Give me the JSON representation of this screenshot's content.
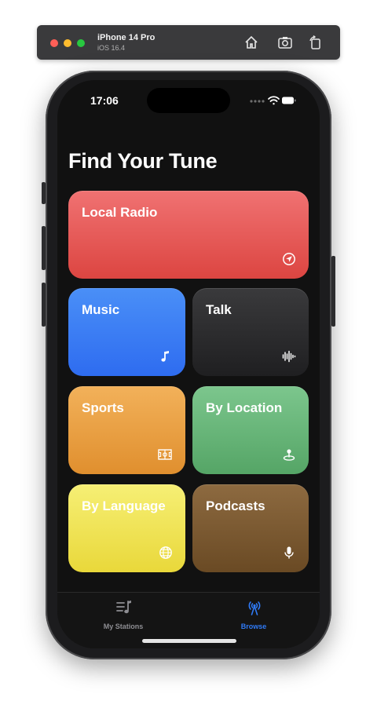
{
  "simulator": {
    "device": "iPhone 14 Pro",
    "os": "iOS 16.4",
    "toolbar_icons": [
      "home-icon",
      "screenshot-icon",
      "rotate-icon"
    ]
  },
  "status_bar": {
    "time": "17:06",
    "icons": [
      "signal-dots-icon",
      "wifi-icon",
      "battery-icon"
    ]
  },
  "page": {
    "title": "Find Your Tune"
  },
  "tiles": [
    {
      "label": "Local Radio",
      "icon": "location-arrow-icon",
      "color": "#e25a57"
    },
    {
      "label": "Music",
      "icon": "music-note-icon",
      "color": "#3a7df4"
    },
    {
      "label": "Talk",
      "icon": "waveform-icon",
      "color": "#2c2c2e"
    },
    {
      "label": "Sports",
      "icon": "soccer-field-icon",
      "color": "#eaa245"
    },
    {
      "label": "By Location",
      "icon": "map-pin-icon",
      "color": "#68b579"
    },
    {
      "label": "By Language",
      "icon": "globe-icon",
      "color": "#f0e456"
    },
    {
      "label": "Podcasts",
      "icon": "microphone-icon",
      "color": "#7b5a33"
    }
  ],
  "tab_bar": {
    "tabs": [
      {
        "label": "My Stations",
        "icon": "music-list-icon",
        "selected": false
      },
      {
        "label": "Browse",
        "icon": "antenna-icon",
        "selected": true
      }
    ],
    "accent_color": "#2f7af6"
  }
}
